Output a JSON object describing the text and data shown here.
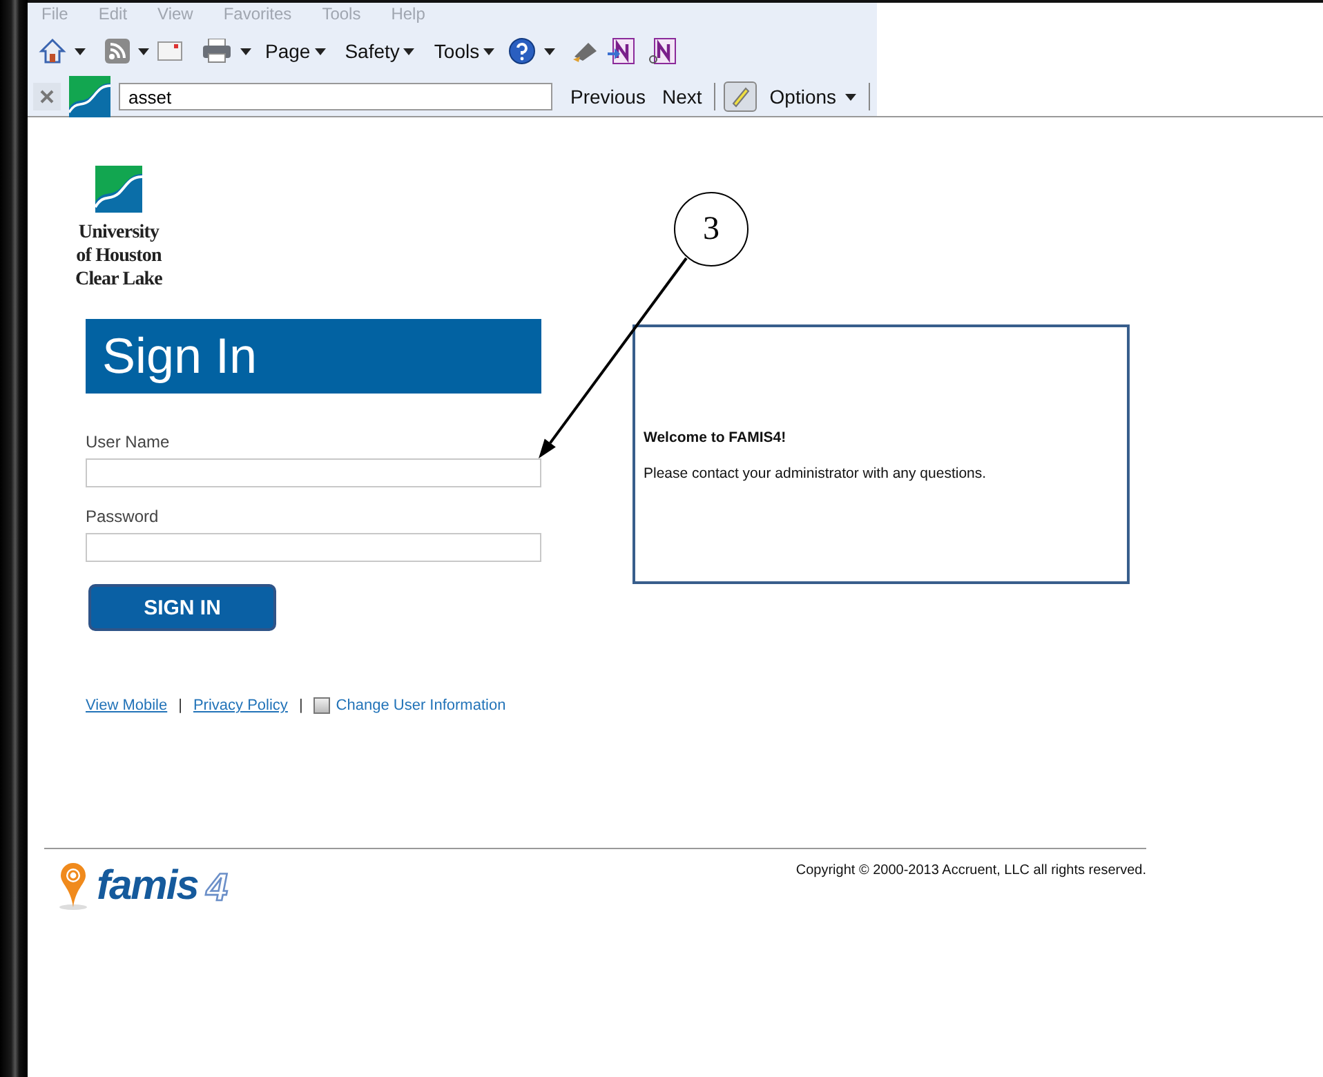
{
  "menu_bar": {
    "items": [
      {
        "label": "File"
      },
      {
        "label": "Edit"
      },
      {
        "label": "View"
      },
      {
        "label": "Favorites"
      },
      {
        "label": "Tools"
      },
      {
        "label": "Help"
      }
    ]
  },
  "toolbar": {
    "menus": [
      {
        "label": "Page"
      },
      {
        "label": "Safety"
      },
      {
        "label": "Tools"
      }
    ]
  },
  "find_bar": {
    "query": "asset",
    "buttons": [
      {
        "label": "Previous"
      },
      {
        "label": "Next"
      }
    ],
    "options": {
      "label": "Options"
    }
  },
  "logo": {
    "lines": [
      "University",
      "of Houston",
      "Clear Lake"
    ]
  },
  "sign_in": {
    "title": "Sign In",
    "fields": [
      {
        "label": "User Name"
      },
      {
        "label": "Password"
      }
    ],
    "button": "SIGN IN"
  },
  "welcome": {
    "heading": "Welcome to FAMIS4!",
    "message": "Please contact your administrator with any questions."
  },
  "links": [
    {
      "kind": "link",
      "label": "View Mobile"
    },
    {
      "kind": "separator",
      "label": "|"
    },
    {
      "kind": "link",
      "label": "Privacy Policy"
    },
    {
      "kind": "separator",
      "label": "|"
    },
    {
      "kind": "checkbox",
      "label": "Change User Information",
      "checked": false
    }
  ],
  "footer": {
    "brand": "famis",
    "version": "4",
    "copyright": "Copyright © 2000-2013 Accruent, LLC all rights reserved."
  },
  "annotation": {
    "label": "3"
  }
}
